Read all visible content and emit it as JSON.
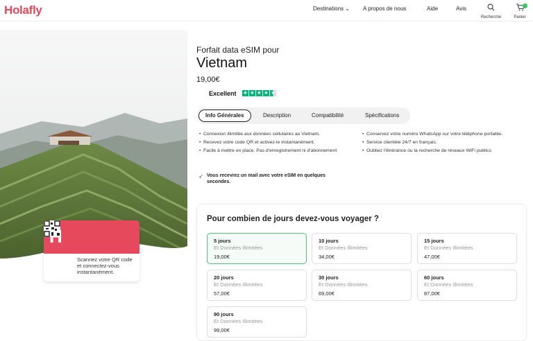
{
  "header": {
    "logo": "Holafly",
    "nav": {
      "destinations": "Destinations ⌄",
      "about": "A propos de nous",
      "help": "Aide",
      "reviews": "Avis"
    },
    "search_label": "Recherche",
    "cart_label": "Panier",
    "icons": {
      "search": "search-icon",
      "cart": "cart-icon"
    },
    "accent_color": "#e6485b"
  },
  "hero": {
    "sim_logo": "H",
    "sim_text": "Scannez votre QR code et connectez-vous instantanément.",
    "sim_color": "#e5495b"
  },
  "product": {
    "pre_title": "Forfait data eSIM pour",
    "title": "Vietnam",
    "price": "19,00€",
    "rating_label": "Excellent",
    "stars": 4.5
  },
  "tabs": [
    {
      "label": "Info Générales",
      "active": true
    },
    {
      "label": "Description",
      "active": false
    },
    {
      "label": "Compatibilité",
      "active": false
    },
    {
      "label": "Spécifications",
      "active": false
    }
  ],
  "features_left": [
    "Connexion illimitée aux données cellulaires au Vietnam.",
    "Recevez votre code QR et activez-le instantanément.",
    "Facile à mettre en place. Pas d'enregistrement ni d'abonnement"
  ],
  "features_right": [
    "Conservez votre numéro WhatsApp sur votre téléphone portable.",
    "Service clientèle 24/7 en français.",
    "Oubliez l'itinérance ou la recherche de réseaux WiFi publics"
  ],
  "mail_note": "Vous recevrez un mail avec votre eSIM en quelques secondes.",
  "duration": {
    "title": "Pour combien de jours devez-vous voyager ?",
    "plans": [
      {
        "days": "5 jours",
        "sub": "Et Données Illimitées",
        "price": "19,00€",
        "selected": true
      },
      {
        "days": "10 jours",
        "sub": "Et Données Illimitées",
        "price": "34,00€",
        "selected": false
      },
      {
        "days": "15 jours",
        "sub": "Et Données Illimitées",
        "price": "47,00€",
        "selected": false
      },
      {
        "days": "20 jours",
        "sub": "Et Données Illimitées",
        "price": "57,00€",
        "selected": false
      },
      {
        "days": "30 jours",
        "sub": "Et Données Illimitées",
        "price": "69,00€",
        "selected": false
      },
      {
        "days": "60 jours",
        "sub": "Et Données Illimitées",
        "price": "87,00€",
        "selected": false
      },
      {
        "days": "90 jours",
        "sub": "Et Données Illimitées",
        "price": "99,00€",
        "selected": false
      }
    ],
    "selected_color": "#4cc27a"
  }
}
